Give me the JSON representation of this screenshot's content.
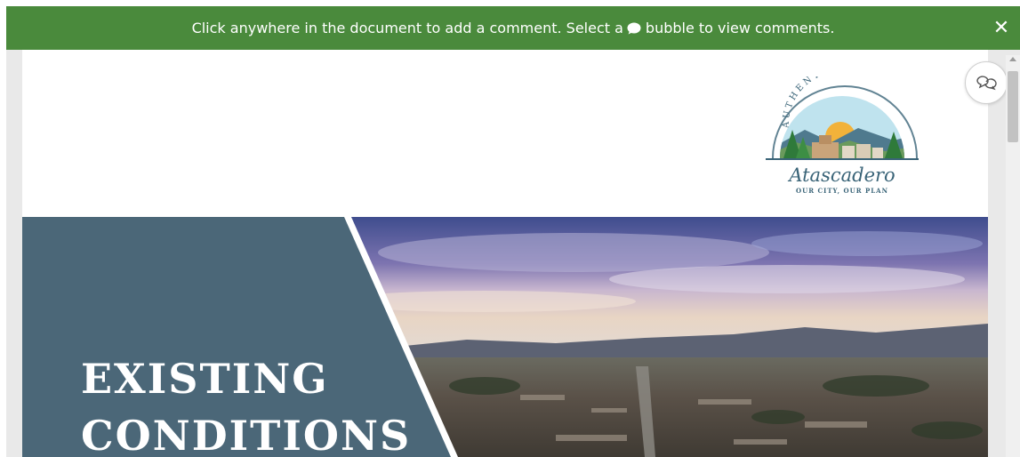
{
  "banner": {
    "text_before": "Click anywhere in the document to add a comment. Select a",
    "text_after": "bubble to view comments.",
    "close_label": "✕",
    "color": "#4a8a3c"
  },
  "logo": {
    "arc_text": "AUTHENTIC",
    "name": "Atascadero",
    "tagline": "OUR CITY, OUR PLAN"
  },
  "hero": {
    "title_line1": "EXISTING",
    "title_line2": "CONDITIONS",
    "panel_color": "#4b6778"
  },
  "comments_button": {
    "icon": "chat-bubbles-icon"
  }
}
